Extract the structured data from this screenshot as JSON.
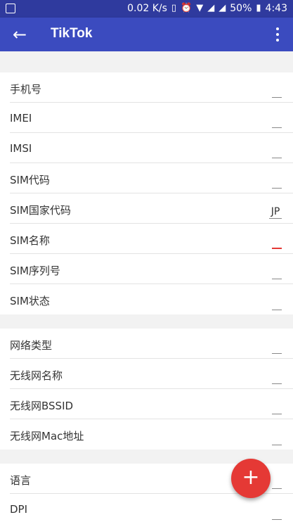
{
  "status_bar": {
    "speed": "0.02 K/s",
    "battery": "50%",
    "time": "4:43"
  },
  "app_bar": {
    "title": "TikTok"
  },
  "sections": [
    {
      "rows": [
        {
          "label": "手机号",
          "value": ""
        },
        {
          "label": "IMEI",
          "value": ""
        },
        {
          "label": "IMSI",
          "value": ""
        },
        {
          "label": "SIM代码",
          "value": ""
        },
        {
          "label": "SIM国家代码",
          "value": "JP"
        },
        {
          "label": "SIM名称",
          "value": ""
        },
        {
          "label": "SIM序列号",
          "value": ""
        },
        {
          "label": "SIM状态",
          "value": ""
        }
      ]
    },
    {
      "rows": [
        {
          "label": "网络类型",
          "value": ""
        },
        {
          "label": "无线网名称",
          "value": ""
        },
        {
          "label": "无线网BSSID",
          "value": ""
        },
        {
          "label": "无线网Mac地址",
          "value": ""
        }
      ]
    },
    {
      "rows": [
        {
          "label": "语言",
          "value": ""
        },
        {
          "label": "DPI",
          "value": ""
        }
      ]
    }
  ],
  "fab": {
    "label": "+"
  }
}
